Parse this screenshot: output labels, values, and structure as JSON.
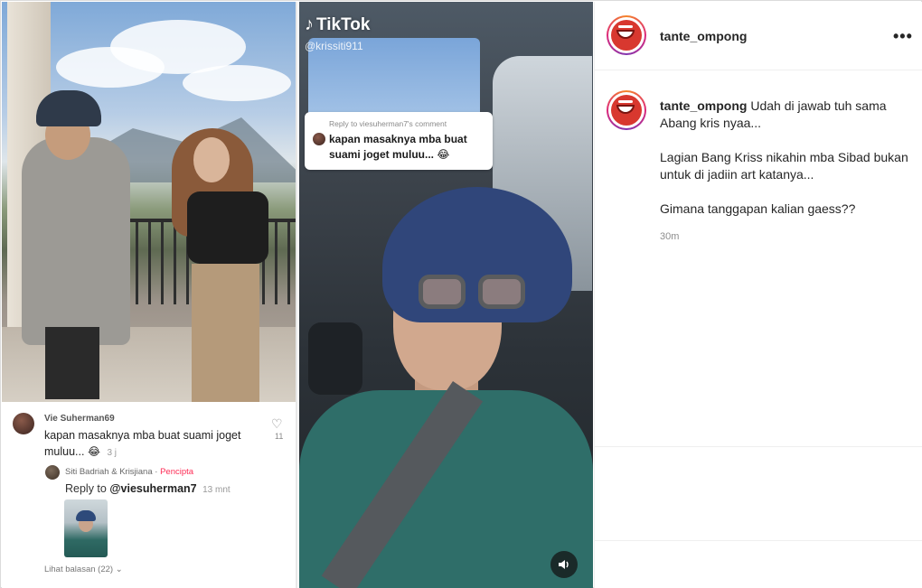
{
  "left_video": {
    "comment": {
      "user": "Vie Suherman69",
      "text": "kapan masaknya mba buat suami joget muluu...",
      "emoji": "😂",
      "time": "3 j",
      "likes": "11"
    },
    "reply": {
      "user": "Siti Badriah & Krisjiana",
      "separator": " · ",
      "creator_tag": "Pencipta",
      "prefix": "Reply to",
      "mention": "@viesuherman7",
      "time": "13 mnt"
    },
    "view_replies": "Lihat balasan (22)"
  },
  "right_video": {
    "logo": "TikTok",
    "username": "@krissiti911",
    "reply_caption": "Reply to viesuherman7's comment",
    "reply_text": "kapan masaknya mba buat suami joget muluu...",
    "reply_emoji": "😂"
  },
  "post": {
    "username": "tante_ompong",
    "caption_user": "tante_ompong",
    "caption_line1": "Udah di jawab tuh sama Abang kris nyaa...",
    "caption_line2": "Lagian Bang Kriss nikahin mba Sibad bukan untuk di jadiin art katanya...",
    "caption_line3": "Gimana tanggapan kalian gaess??",
    "time": "30m"
  },
  "icons": {
    "more": "more-options-icon",
    "heart": "heart-icon",
    "sound": "speaker-icon",
    "chevron": "chevron-down-icon",
    "tiktok_note": "tiktok-note-icon"
  }
}
